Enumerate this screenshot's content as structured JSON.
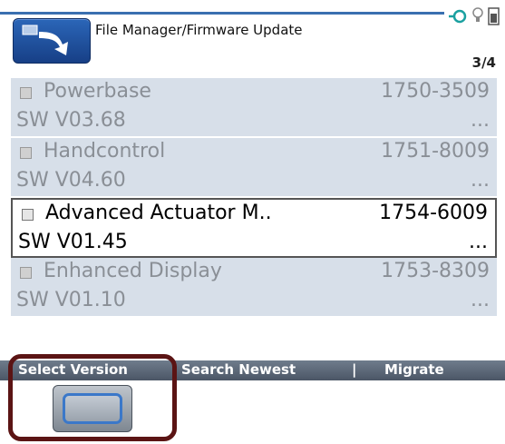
{
  "header": {
    "title": "File Manager/Firmware Update",
    "page_counter": "3/4",
    "app_icon": "firmware-update-icon",
    "status_icons": [
      "connection-icon",
      "bulb-icon",
      "battery-icon"
    ],
    "accent_color": "#3a6fb0"
  },
  "list": {
    "items": [
      {
        "name": "Powerbase",
        "part": "1750-3509",
        "version": "SW V03.68",
        "more": "...",
        "selected": false
      },
      {
        "name": "Handcontrol",
        "part": "1751-8009",
        "version": "SW V04.60",
        "more": "...",
        "selected": false
      },
      {
        "name": "Advanced Actuator M..",
        "part": "1754-6009",
        "version": "SW V01.45",
        "more": "...",
        "selected": true
      },
      {
        "name": "Enhanced Display",
        "part": "1753-8309",
        "version": "SW V01.10",
        "more": "...",
        "selected": false
      }
    ]
  },
  "softkeys": {
    "select_version": "Select Version",
    "search_newest": "Search Newest",
    "separator": "|",
    "migrate": "Migrate"
  },
  "colors": {
    "row_background": "#d7dfe9",
    "softkey_bar": "#5b6778",
    "callout_border": "#5b1414",
    "button_frame": "#3b78c9"
  }
}
